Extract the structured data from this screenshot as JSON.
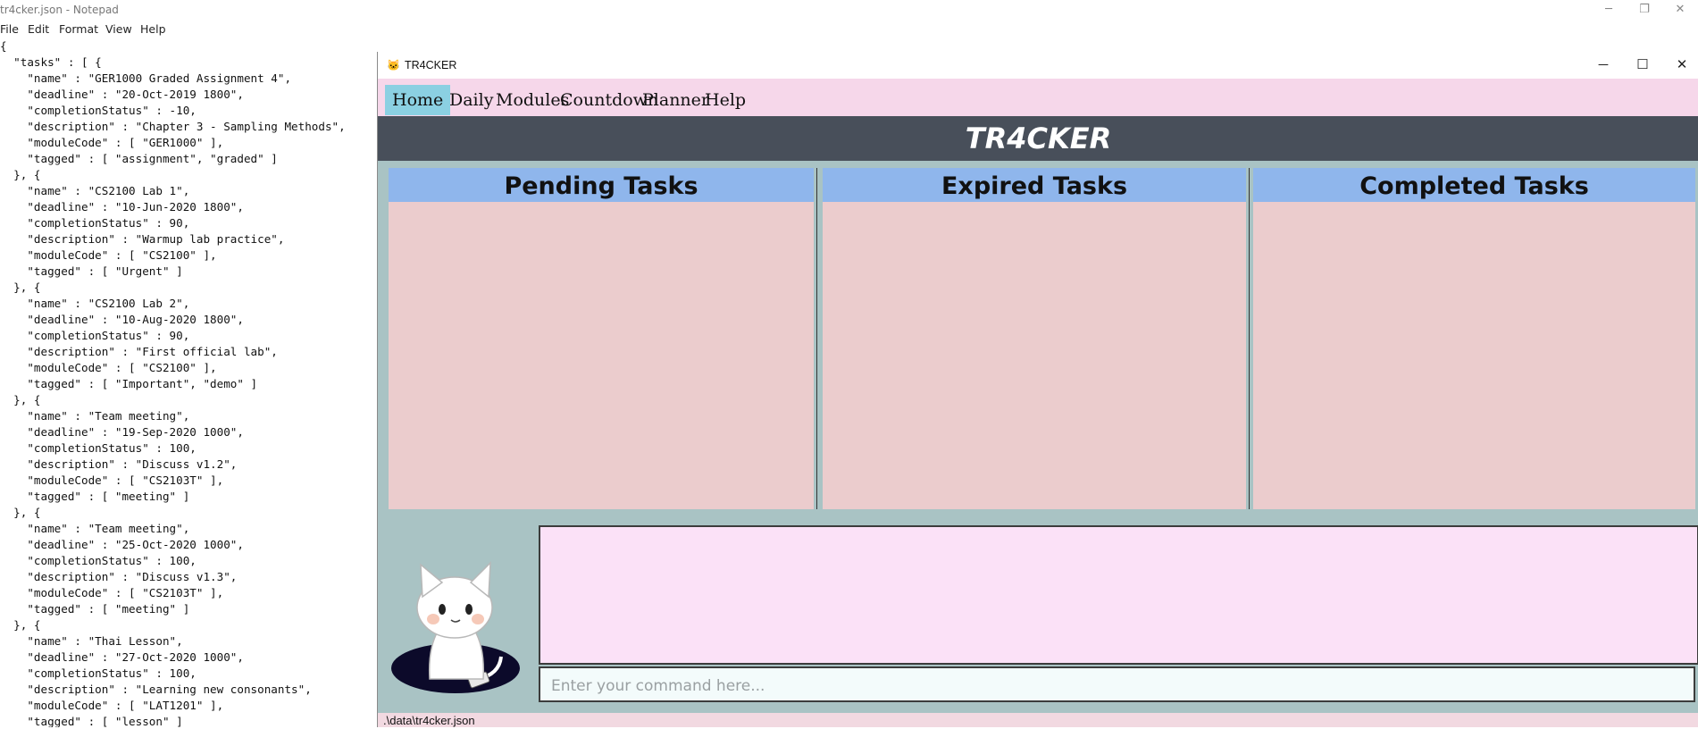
{
  "notepad": {
    "title": "tr4cker.json - Notepad",
    "menu": [
      "File",
      "Edit",
      "Format",
      "View",
      "Help"
    ],
    "content": "{\n  \"tasks\" : [ {\n    \"name\" : \"GER1000 Graded Assignment 4\",\n    \"deadline\" : \"20-Oct-2019 1800\",\n    \"completionStatus\" : -10,\n    \"description\" : \"Chapter 3 - Sampling Methods\",\n    \"moduleCode\" : [ \"GER1000\" ],\n    \"tagged\" : [ \"assignment\", \"graded\" ]\n  }, {\n    \"name\" : \"CS2100 Lab 1\",\n    \"deadline\" : \"10-Jun-2020 1800\",\n    \"completionStatus\" : 90,\n    \"description\" : \"Warmup lab practice\",\n    \"moduleCode\" : [ \"CS2100\" ],\n    \"tagged\" : [ \"Urgent\" ]\n  }, {\n    \"name\" : \"CS2100 Lab 2\",\n    \"deadline\" : \"10-Aug-2020 1800\",\n    \"completionStatus\" : 90,\n    \"description\" : \"First official lab\",\n    \"moduleCode\" : [ \"CS2100\" ],\n    \"tagged\" : [ \"Important\", \"demo\" ]\n  }, {\n    \"name\" : \"Team meeting\",\n    \"deadline\" : \"19-Sep-2020 1000\",\n    \"completionStatus\" : 100,\n    \"description\" : \"Discuss v1.2\",\n    \"moduleCode\" : [ \"CS2103T\" ],\n    \"tagged\" : [ \"meeting\" ]\n  }, {\n    \"name\" : \"Team meeting\",\n    \"deadline\" : \"25-Oct-2020 1000\",\n    \"completionStatus\" : 100,\n    \"description\" : \"Discuss v1.3\",\n    \"moduleCode\" : [ \"CS2103T\" ],\n    \"tagged\" : [ \"meeting\" ]\n  }, {\n    \"name\" : \"Thai Lesson\",\n    \"deadline\" : \"27-Oct-2020 1000\",\n    \"completionStatus\" : 100,\n    \"description\" : \"Learning new consonants\",\n    \"moduleCode\" : [ \"LAT1201\" ],\n    \"tagged\" : [ \"lesson\" ]"
  },
  "app": {
    "window_title": "TR4CKER",
    "menu": [
      "Home",
      "Daily",
      "Modules",
      "Countdown",
      "Planner",
      "Help"
    ],
    "active_menu": "Home",
    "banner": "TR4CKER",
    "panels": [
      "Pending Tasks",
      "Expired Tasks",
      "Completed Tasks"
    ],
    "command_placeholder": "Enter your command here...",
    "status_path": ".\\data\\tr4cker.json"
  },
  "colors": {
    "menubar": "#f6d7ea",
    "active_tab": "#8bd0e2",
    "banner": "#484f5a",
    "panel_header": "#8fb6ec",
    "panel_body": "#ebcccd",
    "background": "#a9c3c4",
    "result_box": "#fbe1f7"
  }
}
